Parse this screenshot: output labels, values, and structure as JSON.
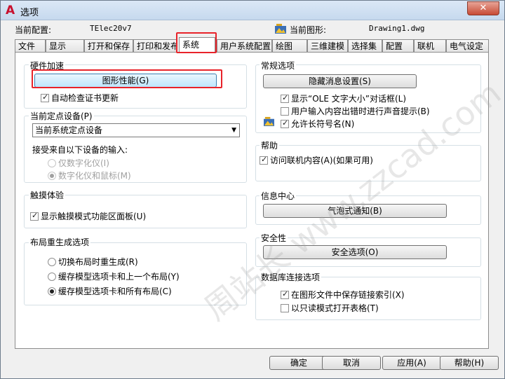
{
  "window": {
    "title": "选项",
    "close_glyph": "✕"
  },
  "info": {
    "profile_label": "当前配置:",
    "profile_value": "TElec20v7",
    "drawing_label": "当前图形:",
    "drawing_value": "Drawing1.dwg"
  },
  "tabs": [
    "文件",
    "显示",
    "打开和保存",
    "打印和发布",
    "系统",
    "用户系统配置",
    "绘图",
    "三维建模",
    "选择集",
    "配置",
    "联机",
    "电气设定"
  ],
  "hardware": {
    "title": "硬件加速",
    "perf_button": "图形性能(G)",
    "auto_check": "自动检查证书更新"
  },
  "pointing": {
    "title": "当前定点设备(P)",
    "selected": "当前系统定点设备",
    "accept_label": "接受来自以下设备的输入:",
    "options": [
      "仅数字化仪(I)",
      "数字化仪和鼠标(M)"
    ]
  },
  "touch": {
    "title": "触摸体验",
    "show_panel": "显示触摸模式功能区面板(U)"
  },
  "layout_regen": {
    "title": "布局重生成选项",
    "options": [
      "切换布局时重生成(R)",
      "缓存模型选项卡和上一个布局(Y)",
      "缓存模型选项卡和所有布局(C)"
    ]
  },
  "general": {
    "title": "常规选项",
    "hidden_msgs_button": "隐藏消息设置(S)",
    "checks": [
      "显示“OLE 文字大小”对话框(L)",
      "用户输入内容出错时进行声音提示(B)",
      "允许长符号名(N)"
    ]
  },
  "help": {
    "title": "帮助",
    "online": "访问联机内容(A)(如果可用)"
  },
  "info_center": {
    "title": "信息中心",
    "balloon_button": "气泡式通知(B)"
  },
  "security": {
    "title": "安全性",
    "security_button": "安全选项(O)"
  },
  "db": {
    "title": "数据库连接选项",
    "checks": [
      "在图形文件中保存链接索引(X)",
      "以只读模式打开表格(T)"
    ]
  },
  "footer": {
    "ok": "确定",
    "cancel": "取消",
    "apply": "应用(A)",
    "help": "帮助(H)"
  },
  "watermark": "周站长 www.zzcad.com"
}
